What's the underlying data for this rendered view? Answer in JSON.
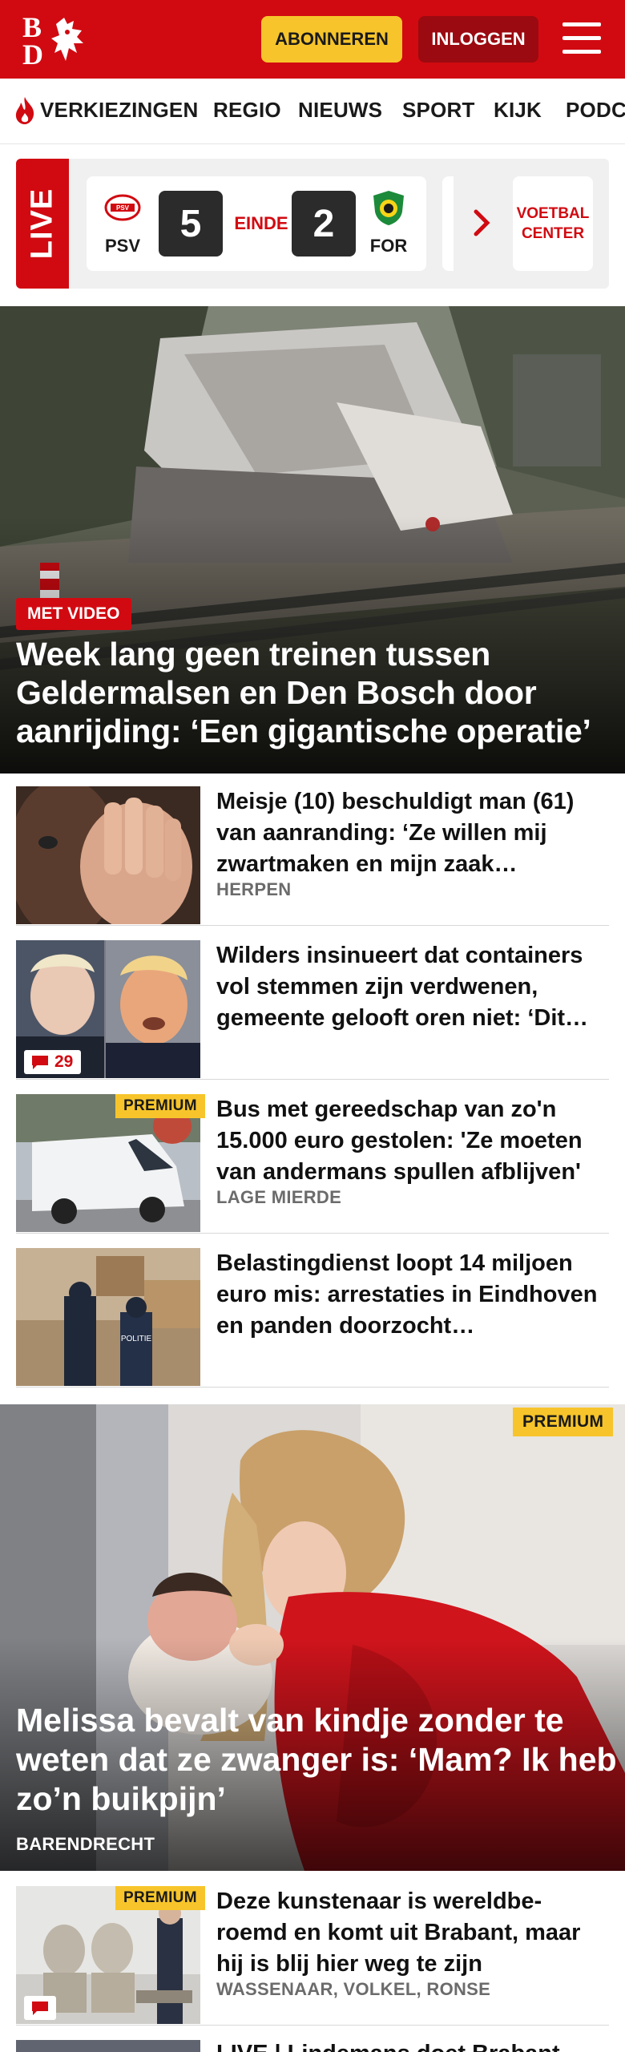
{
  "header": {
    "logo_top": "B",
    "logo_bottom": "D",
    "subscribe_label": "ABONNEREN",
    "login_label": "INLOGGEN",
    "brand_color": "#d10a11",
    "accent_color": "#f7c52b"
  },
  "nav": {
    "items": [
      "VERKIEZINGEN",
      "REGIO",
      "NIEUWS",
      "SPORT",
      "KIJK",
      "PODCASTS"
    ]
  },
  "live": {
    "label": "LIVE",
    "home_team": "PSV",
    "away_team": "FOR",
    "home_score": "5",
    "away_score": "2",
    "status": "EINDE",
    "voetbal_line1": "VOETBAL",
    "voetbal_line2": "CENTER"
  },
  "hero": {
    "tag": "MET VIDEO",
    "title": "Week lang geen treinen tussen Geldermalsen en Den Bosch door aanrijding: ‘Een gigantische operatie’"
  },
  "articles": [
    {
      "title": "Meisje (10) beschuldigt man (61) van aanranding: ‘Ze willen mij zwartmaken en mijn zaak…",
      "location": "HERPEN"
    },
    {
      "title": "Wilders insinueert dat containers vol stemmen zijn verdwenen, gemeente gelooft oren niet: ‘Dit…",
      "comments": "29"
    },
    {
      "title": "Bus met gereedschap van zo'n 15.000 euro gestolen: 'Ze moeten van andermans spullen afblijven'",
      "location": "LAGE MIERDE",
      "badge": "PREMIUM"
    },
    {
      "title": "Belastingdienst loopt 14 miljoen euro mis: arrestaties in Eindhoven en panden doorzocht…"
    }
  ],
  "feature": {
    "badge": "PREMIUM",
    "title": "Melissa bevalt van kindje zonder te weten dat ze zwanger is: ‘Mam? Ik heb zo’n buikpijn’",
    "location": "BARENDRECHT"
  },
  "article5": {
    "badge": "PREMIUM",
    "title": "Deze kunstenaar is wereldbe-roemd en komt uit Brabant, maar hij is blij hier weg te zijn",
    "location": "WASSENAAR, VOLKEL, RONSE"
  },
  "article6": {
    "title": "LIVE | Lindemans doet Brabant…"
  }
}
